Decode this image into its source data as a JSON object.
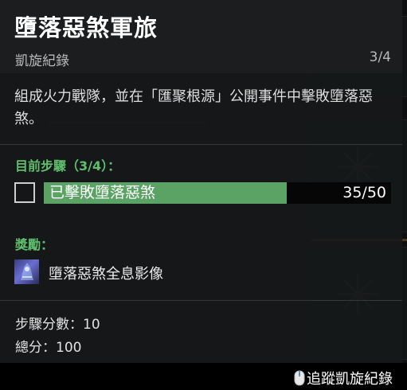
{
  "header": {
    "title": "墮落惡煞軍旅",
    "subtitle": "凱旋紀錄",
    "progress": "3/4"
  },
  "description": "組成火力戰隊，並在「匯聚根源」公開事件中擊敗墮落惡煞。",
  "current_step": {
    "heading": "目前步驟（3/4）：",
    "objective": "已擊敗墮落惡煞",
    "progress_text": "35/50",
    "progress_fraction": 0.7,
    "completed": false
  },
  "rewards": {
    "heading": "獎勵：",
    "items": [
      {
        "name": "墮落惡煞全息影像",
        "icon": "hologram-emblem-icon"
      }
    ]
  },
  "stats": {
    "step_score": "步驟分數：10",
    "total_score": "總分：100"
  },
  "footer": {
    "track_label": "追蹤凱旋紀錄",
    "icon": "mouse-icon"
  },
  "colors": {
    "accent_green": "#5fbf6d",
    "bar_fill": "#5ba365"
  }
}
